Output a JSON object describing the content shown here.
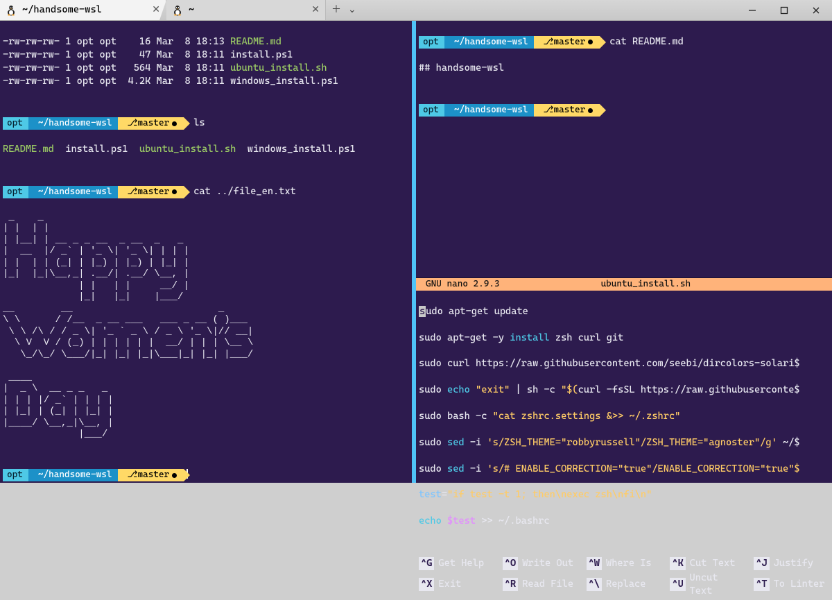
{
  "window": {
    "tabs": [
      {
        "title": "~/handsome-wsl",
        "active": true
      },
      {
        "title": "~",
        "active": false
      }
    ]
  },
  "prompt": {
    "user": "opt",
    "path": "~/handsome-wsl",
    "branch_glyph": "⎇",
    "branch": "master"
  },
  "left": {
    "listing": [
      {
        "perm": "-rw-rw-rw-",
        "n": "1",
        "u": "opt",
        "g": "opt",
        "size": "16",
        "date": "Mar  8 18:13",
        "name": "README.md",
        "cls": "ls-green"
      },
      {
        "perm": "-rw-rw-rw-",
        "n": "1",
        "u": "opt",
        "g": "opt",
        "size": "47",
        "date": "Mar  8 18:11",
        "name": "install.ps1",
        "cls": ""
      },
      {
        "perm": "-rw-rw-rw-",
        "n": "1",
        "u": "opt",
        "g": "opt",
        "size": "564",
        "date": "Mar  8 18:11",
        "name": "ubuntu_install.sh",
        "cls": "ls-green"
      },
      {
        "perm": "-rw-rw-rw-",
        "n": "1",
        "u": "opt",
        "g": "opt",
        "size": "4.2K",
        "date": "Mar  8 18:11",
        "name": "windows_install.ps1",
        "cls": ""
      }
    ],
    "cmd_ls": "ls",
    "ls_out": {
      "a": "README.md",
      "b": "install.ps1",
      "c": "ubuntu_install.sh",
      "d": "windows_install.ps1"
    },
    "cmd_cat": "cat ../file_en.txt",
    "ascii": " _    _\n| |  | |\n| |__| | __ _ _ __  _ __  _   _\n|  __  |/ _` | '_ \\| '_ \\| | | |\n| |  | | (_| | |_) | |_) | |_| |\n|_|  |_|\\__,_| .__/| .__/ \\__, |\n             | |   | |     __/ |\n             |_|   |_|    |___/\n__        __                         _\n\\ \\      / /__  _ __ ___   ___ _ __ ( )___\n \\ \\ /\\ / / _ \\| '_ ` _ \\ / _ \\ '_ \\|// __|\n  \\ V  V / (_) | | | | | |  __/ | | | \\__ \\\n   \\_/\\_/ \\___/|_| |_| |_|\\___|_| |_| |___/\n\n ____\n|  _ \\  __ _ _   _\n| | | |/ _` | | | |\n| |_| | (_| | |_| |\n|____/ \\__,_|\\__, |\n             |___/"
  },
  "right_top": {
    "cmd": "cat README.md",
    "out": "## handsome-wsl"
  },
  "nano": {
    "app": "GNU nano 2.9.3",
    "file": "ubuntu_install.sh",
    "lines": {
      "l1a": "s",
      "l1b": "udo apt-get update",
      "l2": "sudo apt-get -y ",
      "l2b": "install",
      "l2c": " zsh curl git",
      "l3": "sudo curl https://raw.githubusercontent.com/seebi/dircolors-solari$",
      "l4a": "sudo ",
      "l4b": "echo ",
      "l4c": "\"exit\"",
      "l4d": " | sh -c ",
      "l4e": "\"$(",
      "l4f": "curl -fsSL https://raw.githubuserconte$",
      "l5a": "sudo bash -c ",
      "l5b": "\"cat zshrc.settings &>> ~/.zshrc\"",
      "l6a": "sudo ",
      "l6b": "sed",
      "l6c": " -i ",
      "l6d": "'s/ZSH_THEME=\"robbyrussell\"/ZSH_THEME=\"agnoster\"/g'",
      "l6e": " ~/$",
      "l7a": "sudo ",
      "l7b": "sed",
      "l7c": " -i ",
      "l7d": "'s/# ENABLE_CORRECTION=\"true\"/ENABLE_CORRECTION=\"true\"$",
      "l8a": "test",
      "l8b": "=",
      "l8c": "\"if test -t 1; then\\nexec zsh\\nfi\\n\"",
      "l9a": "echo ",
      "l9b": "$test",
      "l9c": " >> ~/.bashrc"
    },
    "footer": [
      {
        "k": "^G",
        "t": "Get Help"
      },
      {
        "k": "^O",
        "t": "Write Out"
      },
      {
        "k": "^W",
        "t": "Where Is"
      },
      {
        "k": "^K",
        "t": "Cut Text"
      },
      {
        "k": "^J",
        "t": "Justify"
      },
      {
        "k": "^X",
        "t": "Exit"
      },
      {
        "k": "^R",
        "t": "Read File"
      },
      {
        "k": "^\\",
        "t": "Replace"
      },
      {
        "k": "^U",
        "t": "Uncut Text"
      },
      {
        "k": "^T",
        "t": "To Linter"
      }
    ]
  }
}
